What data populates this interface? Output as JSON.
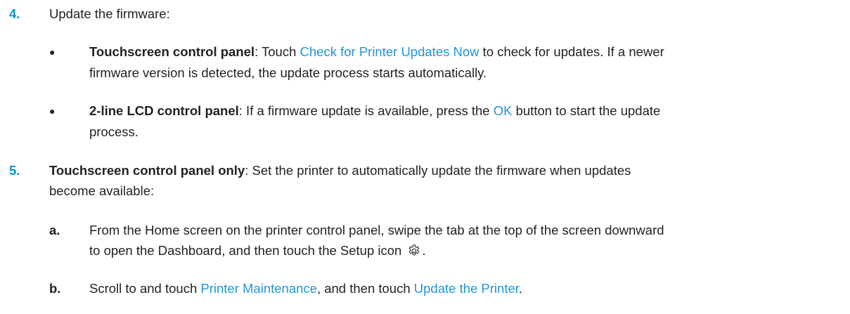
{
  "step4": {
    "number": "4.",
    "text": "Update the firmware:",
    "bullets": [
      {
        "bullet": "●",
        "label": "Touchscreen control panel",
        "sep": ": Touch ",
        "link": "Check for Printer Updates Now",
        "rest": " to check for updates. If a newer",
        "line2": "firmware version is detected, the update process starts automatically."
      },
      {
        "bullet": "●",
        "label": "2-line LCD control panel",
        "sep": ": If a firmware update is available, press the ",
        "link": "OK",
        "rest": " button to start the update",
        "line2": "process."
      }
    ]
  },
  "step5": {
    "number": "5.",
    "label": "Touchscreen control panel only",
    "rest": ": Set the printer to automatically update the firmware when updates",
    "line2": "become available:",
    "substeps": [
      {
        "letter": "a.",
        "line1": "From the Home screen on the printer control panel, swipe the tab at the top of the screen downward",
        "line2_pre": "to open the Dashboard, and then touch the Setup icon ",
        "icon": "gear-icon",
        "line2_post": "."
      },
      {
        "letter": "b.",
        "pre": "Scroll to and touch ",
        "link1": "Printer Maintenance",
        "mid": ", and then touch ",
        "link2": "Update the Printer",
        "post": "."
      }
    ]
  },
  "colors": {
    "step_number": "#0096d6",
    "link": "#1f97d3",
    "text": "#222222"
  }
}
